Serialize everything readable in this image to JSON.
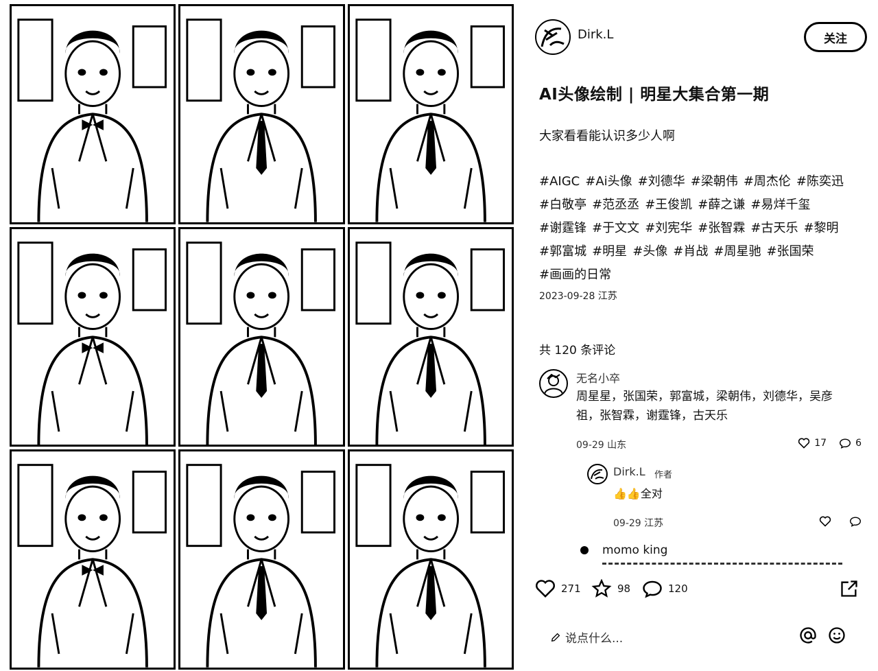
{
  "author": {
    "name": "Dirk.L",
    "follow_label": "关注"
  },
  "post": {
    "title": "AI头像绘制 | 明星大集合第一期",
    "description": "大家看看能认识多少人啊",
    "tags": [
      "#AIGC",
      "#Ai头像",
      "#刘德华",
      "#梁朝伟",
      "#周杰伦",
      "#陈奕迅",
      "#白敬亭",
      "#范丞丞",
      "#王俊凯",
      "#薛之谦",
      "#易烊千玺",
      "#谢霆锋",
      "#于文文",
      "#刘宪华",
      "#张智霖",
      "#古天乐",
      "#黎明",
      "#郭富城",
      "#明星",
      "#头像",
      "#肖战",
      "#周星驰",
      "#张国荣",
      "#画画的日常"
    ],
    "meta": "2023-09-28 江苏"
  },
  "comments_header": "共 120 条评论",
  "comments": [
    {
      "name": "无名小卒",
      "text": "周星星，张国荣，郭富城，梁朝伟，刘德华，吴彦祖，张智霖，谢霆锋，古天乐",
      "meta": "09-29 山东",
      "likes": "17",
      "replies": "6",
      "reply": {
        "name": "Dirk.L",
        "badge": "作者",
        "text": "👍👍全对",
        "meta": "09-29 江苏"
      }
    },
    {
      "name": "momo king"
    }
  ],
  "stats": {
    "likes": "271",
    "favorites": "98",
    "comments": "120"
  },
  "input_placeholder": "说点什么..."
}
